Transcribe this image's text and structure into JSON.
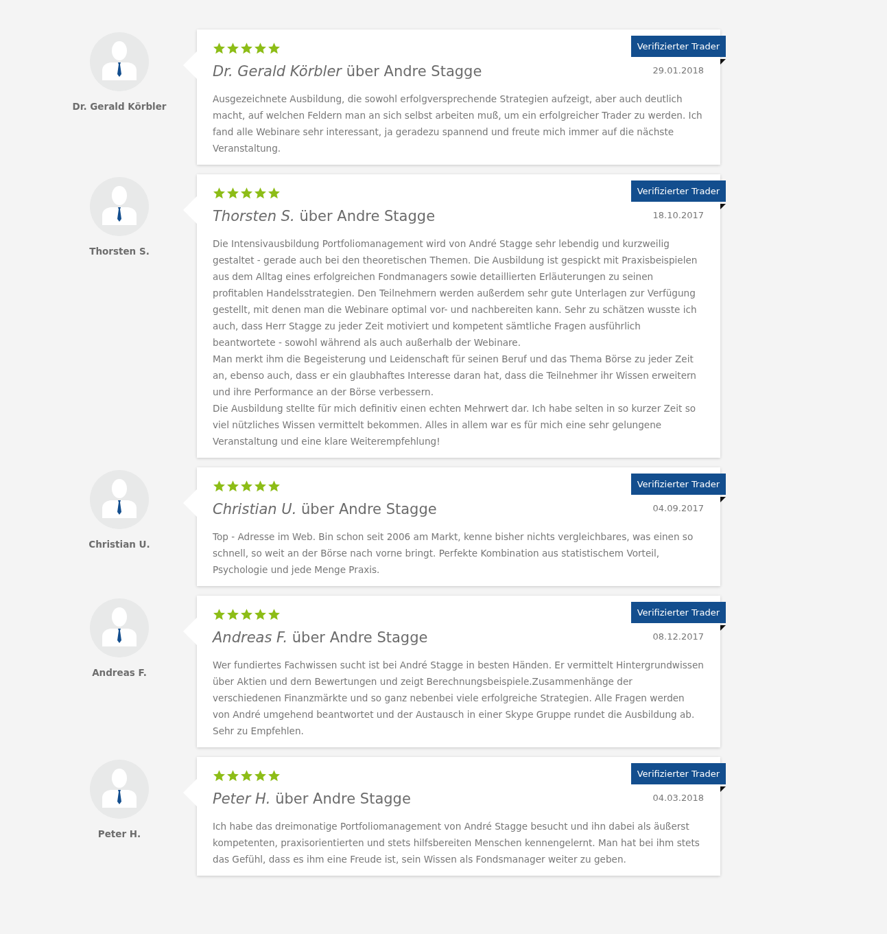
{
  "reviews": [
    {
      "author": "Dr. Gerald Körbler",
      "stars": 5,
      "badge": "Verifizierter Trader",
      "title": "*Dr. Gerald Körbler* über Andre Stagge",
      "date": "29.01.2018",
      "paragraphs": [
        "Ausgezeichnete Ausbildung, die sowohl erfolgversprechende Strategien aufzeigt, aber auch deutlich macht, auf welchen Feldern man an sich selbst arbeiten muß, um ein erfolgreicher Trader zu werden. Ich fand alle Webinare sehr interessant, ja geradezu spannend und freute mich immer auf die nächste Veranstaltung."
      ]
    },
    {
      "author": "Thorsten S.",
      "stars": 5,
      "badge": "Verifizierter Trader",
      "title": "*Thorsten S.* über Andre Stagge",
      "date": "18.10.2017",
      "paragraphs": [
        "Die Intensivausbildung Portfoliomanagement wird von André Stagge sehr lebendig und kurzweilig gestaltet - gerade auch bei den theoretischen Themen. Die Ausbildung ist gespickt mit Praxisbeispielen aus dem Alltag eines erfolgreichen Fondmanagers sowie detaillierten Erläuterungen zu seinen profitablen Handelsstrategien. Den Teilnehmern werden außerdem sehr gute Unterlagen zur Verfügung gestellt, mit denen man die Webinare optimal vor- und nachbereiten kann. Sehr zu schätzen wusste ich auch, dass Herr Stagge zu jeder Zeit motiviert und kompetent sämtliche Fragen ausführlich beantwortete - sowohl während als auch außerhalb der Webinare.",
        "Man merkt ihm die Begeisterung und Leidenschaft für seinen Beruf und das Thema Börse zu jeder Zeit an, ebenso auch, dass er ein glaubhaftes Interesse daran hat, dass die Teilnehmer ihr Wissen erweitern und ihre Performance an der Börse verbessern.",
        "Die Ausbildung stellte für mich definitiv einen echten Mehrwert dar. Ich habe selten in so kurzer Zeit so viel nützliches Wissen vermittelt bekommen. Alles in allem war es für mich eine sehr gelungene Veranstaltung und eine klare Weiterempfehlung!"
      ]
    },
    {
      "author": "Christian U.",
      "stars": 5,
      "badge": "Verifizierter Trader",
      "title": "*Christian U.* über Andre Stagge",
      "date": "04.09.2017",
      "paragraphs": [
        "Top - Adresse im Web. Bin schon seit 2006 am Markt, kenne bisher nichts vergleichbares, was einen so schnell, so weit an der Börse nach vorne bringt. Perfekte Kombination aus statistischem Vorteil, Psychologie und jede Menge Praxis."
      ]
    },
    {
      "author": "Andreas F.",
      "stars": 5,
      "badge": "Verifizierter Trader",
      "title": "*Andreas F.* über Andre Stagge",
      "date": "08.12.2017",
      "paragraphs": [
        "Wer fundiertes Fachwissen sucht ist bei André Stagge in besten Händen. Er vermittelt Hintergrundwissen über Aktien und dern Bewertungen und zeigt Berechnungsbeispiele.Zusammenhänge der verschiedenen Finanzmärkte und so ganz nebenbei viele erfolgreiche Strategien. Alle Fragen werden von André umgehend beantwortet und der Austausch in einer Skype Gruppe rundet die Ausbildung ab. Sehr zu Empfehlen."
      ]
    },
    {
      "author": "Peter H.",
      "stars": 5,
      "badge": "Verifizierter Trader",
      "title": "*Peter H.* über Andre Stagge",
      "date": "04.03.2018",
      "paragraphs": [
        "Ich habe das dreimonatige Portfoliomanagement von André Stagge besucht und ihn dabei als äußerst kompetenten, praxisorientierten und stets hilfsbereiten Menschen kennengelernt. Man hat bei ihm stets das Gefühl, dass es ihm eine Freude ist, sein Wissen als Fondsmanager weiter zu geben."
      ]
    }
  ]
}
